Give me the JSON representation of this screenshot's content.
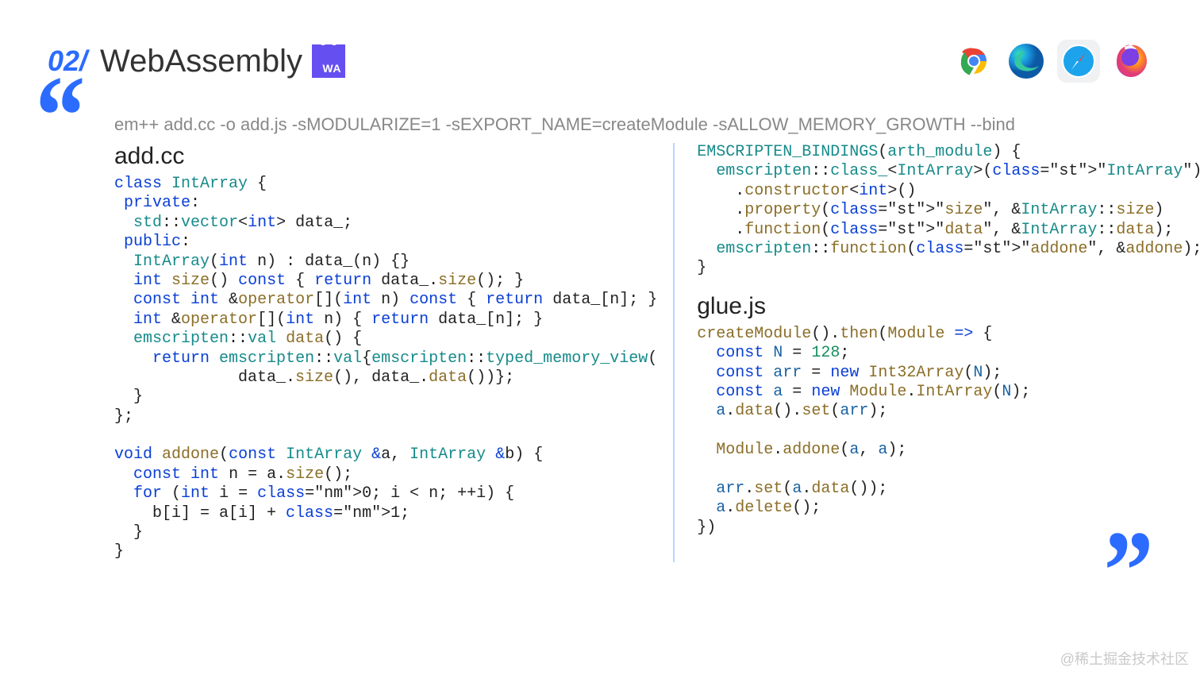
{
  "header": {
    "slide_number": "02/",
    "title": "WebAssembly",
    "wa_badge": "WA"
  },
  "command": "em++ add.cc -o add.js -sMODULARIZE=1 -sEXPORT_NAME=createModule -sALLOW_MEMORY_GROWTH --bind",
  "left_file": "add.cc",
  "right_file": "glue.js",
  "code_left_1": "class IntArray {\n private:\n  std::vector<int> data_;\n public:\n  IntArray(int n) : data_(n) {}\n  int size() const { return data_.size(); }\n  const int &operator[](int n) const { return data_[n]; }\n  int &operator[](int n) { return data_[n]; }\n  emscripten::val data() {\n    return emscripten::val{emscripten::typed_memory_view(\n             data_.size(), data_.data())};\n  }\n};\n\nvoid addone(const IntArray &a, IntArray &b) {\n  const int n = a.size();\n  for (int i = 0; i < n; ++i) {\n    b[i] = a[i] + 1;\n  }\n}",
  "code_right_top": "EMSCRIPTEN_BINDINGS(arth_module) {\n  emscripten::class_<IntArray>(\"IntArray\")\n    .constructor<int>()\n    .property(\"size\", &IntArray::size)\n    .function(\"data\", &IntArray::data);\n  emscripten::function(\"addone\", &addone);\n}",
  "code_right_bottom": "createModule().then(Module => {\n  const N = 128;\n  const arr = new Int32Array(N);\n  const a = new Module.IntArray(N);\n  a.data().set(arr);\n\n  Module.addone(a, a);\n\n  arr.set(a.data());\n  a.delete();\n})",
  "watermark": "@稀土掘金技术社区"
}
